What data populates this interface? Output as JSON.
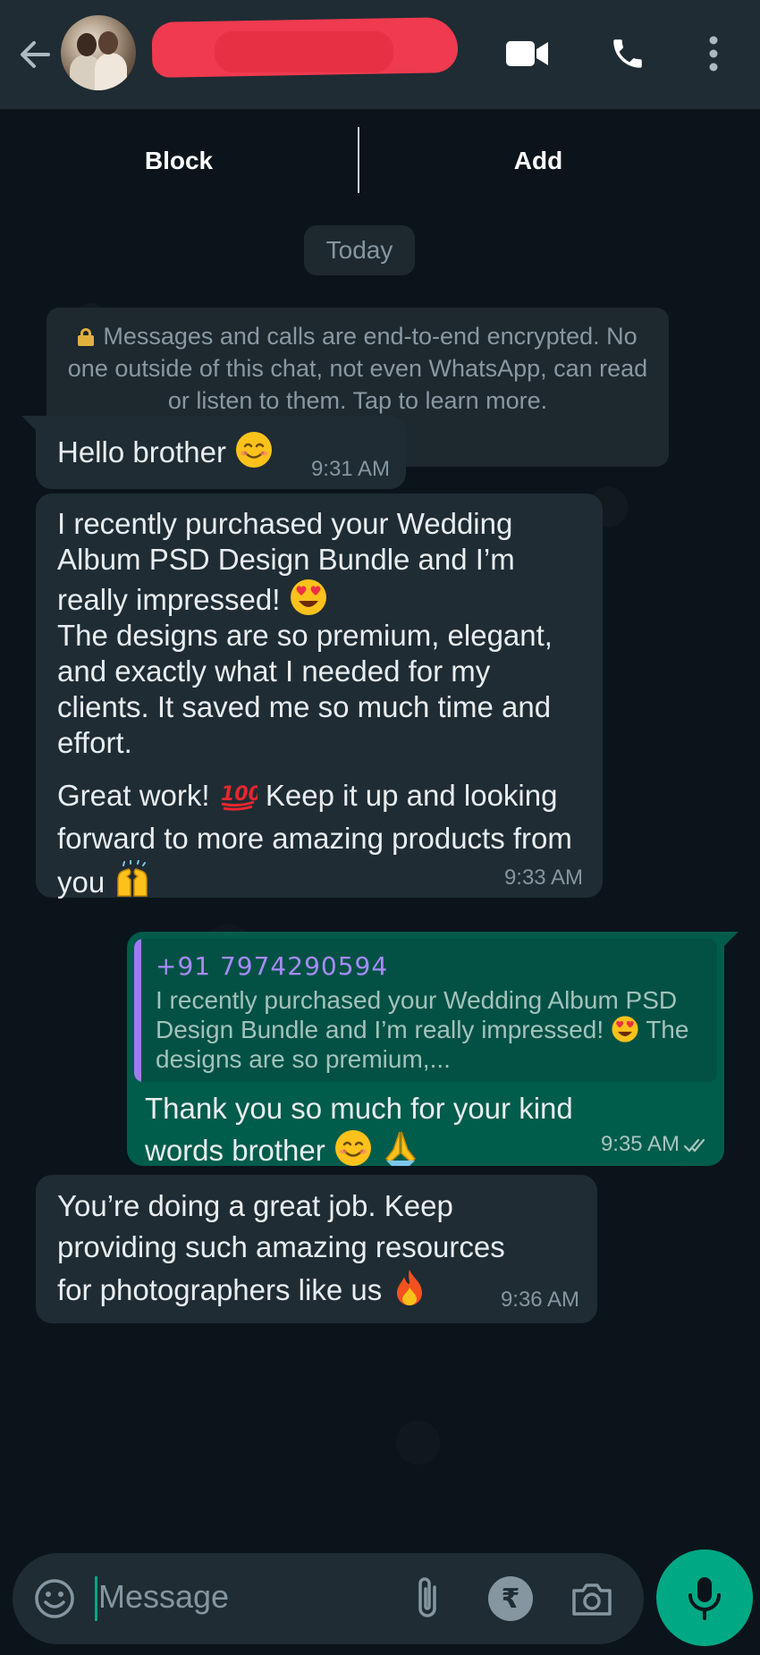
{
  "header": {
    "contact_name": "",
    "icons": [
      "back-arrow-icon",
      "video-call-icon",
      "voice-call-icon",
      "more-options-icon"
    ]
  },
  "actions": {
    "block_label": "Block",
    "add_label": "Add"
  },
  "chat": {
    "date_chip": "Today",
    "encryption_notice": "Messages and calls are end-to-end encrypted. No one outside of this chat, not even WhatsApp, can read or listen to them. Tap to learn more.",
    "messages": [
      {
        "direction": "incoming",
        "text": "Hello brother",
        "emoji": "smiling-face",
        "time": "9:31 AM"
      },
      {
        "direction": "incoming",
        "text_1": "I recently purchased your Wedding Album PSD Design Bundle and I’m really impressed!",
        "emoji_1": "heart-eyes",
        "text_2": "The designs are so premium, elegant, and exactly what I needed for my clients. It saved me so much time and effort.",
        "text_3a": "Great work!",
        "emoji_2": "hundred-points",
        "text_3b": "Keep it up and looking forward to more amazing products from you",
        "emoji_3": "raising-hands",
        "time": "9:33 AM"
      },
      {
        "direction": "outgoing",
        "quote_name": "+91 7974290594",
        "quote_text_a": "I recently purchased your Wedding Album PSD Design Bundle and I’m really impressed!",
        "quote_text_b": "The designs are so premium,...",
        "text": "Thank you so much for your kind words brother",
        "time": "9:35 AM",
        "status": "read"
      },
      {
        "direction": "incoming",
        "text": "You’re doing a great job. Keep providing such amazing resources for photographers like us",
        "emoji": "fire",
        "time": "9:36 AM"
      }
    ]
  },
  "composer": {
    "placeholder": "Message",
    "icons": [
      "emoji-icon",
      "attach-icon",
      "rupee-payment-icon",
      "camera-icon",
      "microphone-icon"
    ]
  },
  "colors": {
    "background": "#0b141a",
    "header": "#1f2c34",
    "incoming_bubble": "#1f2c34",
    "outgoing_bubble": "#005c4b",
    "accent": "#00a884",
    "quote_name": "#a78bfa"
  }
}
